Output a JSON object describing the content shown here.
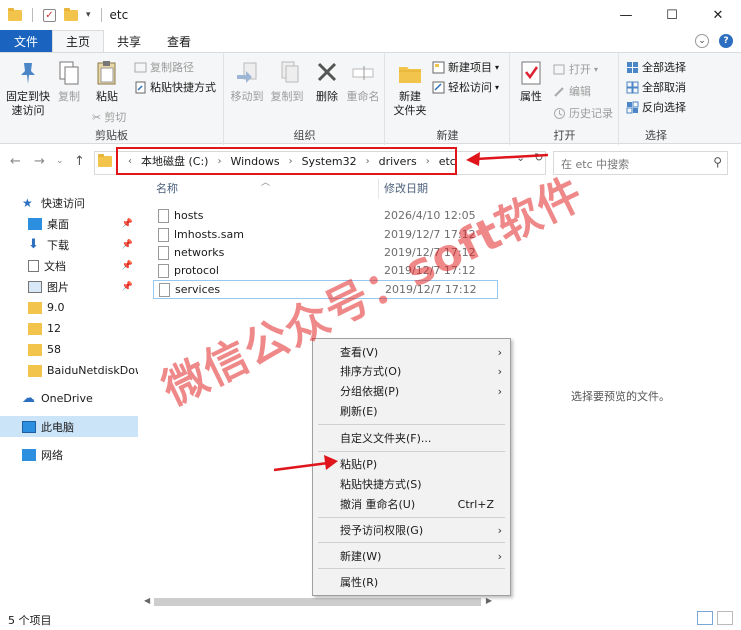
{
  "window": {
    "title": "etc",
    "controls": [
      "minimize-icon",
      "maximize-icon",
      "close-icon"
    ]
  },
  "ribbon_tabs": {
    "file": "文件",
    "home": "主页",
    "share": "共享",
    "view": "查看"
  },
  "ribbon": {
    "clipboard": {
      "label": "剪贴板",
      "pin": "固定到快\n速访问",
      "pin_1": "固定到快",
      "pin_2": "速访问",
      "copy": "复制",
      "paste": "粘贴",
      "copy_path": "复制路径",
      "paste_shortcut": "粘贴快捷方式",
      "cut": "剪切"
    },
    "organize": {
      "label": "组织",
      "move_to": "移动到",
      "copy_to": "复制到",
      "delete": "删除",
      "rename": "重命名"
    },
    "new": {
      "label": "新建",
      "new_folder_1": "新建",
      "new_folder_2": "文件夹",
      "new_item": "新建项目",
      "easy_access": "轻松访问"
    },
    "open": {
      "label": "打开",
      "properties": "属性",
      "open": "打开",
      "edit": "编辑",
      "history": "历史记录"
    },
    "select": {
      "label": "选择",
      "select_all": "全部选择",
      "select_none": "全部取消",
      "invert": "反向选择"
    }
  },
  "address": {
    "crumbs": [
      "本地磁盘 (C:)",
      "Windows",
      "System32",
      "drivers",
      "etc"
    ],
    "search_placeholder": "在 etc 中搜索"
  },
  "sidebar": {
    "items": [
      {
        "label": "快速访问",
        "icon": "star-icon"
      },
      {
        "label": "桌面",
        "icon": "desktop-icon"
      },
      {
        "label": "下载",
        "icon": "download-icon"
      },
      {
        "label": "文档",
        "icon": "document-icon"
      },
      {
        "label": "图片",
        "icon": "picture-icon"
      },
      {
        "label": "9.0",
        "icon": "folder-icon"
      },
      {
        "label": "12",
        "icon": "folder-icon"
      },
      {
        "label": "58",
        "icon": "folder-icon"
      },
      {
        "label": "BaiduNetdiskDow",
        "icon": "folder-icon"
      },
      {
        "label": "OneDrive",
        "icon": "cloud-icon"
      },
      {
        "label": "此电脑",
        "icon": "computer-icon"
      },
      {
        "label": "网络",
        "icon": "network-icon"
      }
    ]
  },
  "file_list": {
    "columns": [
      "名称",
      "修改日期"
    ],
    "rows": [
      {
        "name": "hosts",
        "date": "2026/4/10 12:05"
      },
      {
        "name": "lmhosts.sam",
        "date": "2019/12/7 17:12"
      },
      {
        "name": "networks",
        "date": "2019/12/7 17:12"
      },
      {
        "name": "protocol",
        "date": "2019/12/7 17:12"
      },
      {
        "name": "services",
        "date": "2019/12/7 17:12"
      }
    ]
  },
  "preview_text": "选择要预览的文件。",
  "status": "5 个项目",
  "context_menu": {
    "view": "查看(V)",
    "sort": "排序方式(O)",
    "group": "分组依据(P)",
    "refresh": "刷新(E)",
    "customize": "自定义文件夹(F)...",
    "paste": "粘贴(P)",
    "paste_shortcut": "粘贴快捷方式(S)",
    "undo": "撤消 重命名(U)",
    "undo_shortcut": "Ctrl+Z",
    "grant_access": "授予访问权限(G)",
    "new": "新建(W)",
    "properties": "属性(R)"
  },
  "watermark": "微信公众号：soft软件",
  "colors": {
    "file_tab": "#1a64c0",
    "annotation_red": "#e0151c",
    "selection": "#cce4f7"
  }
}
